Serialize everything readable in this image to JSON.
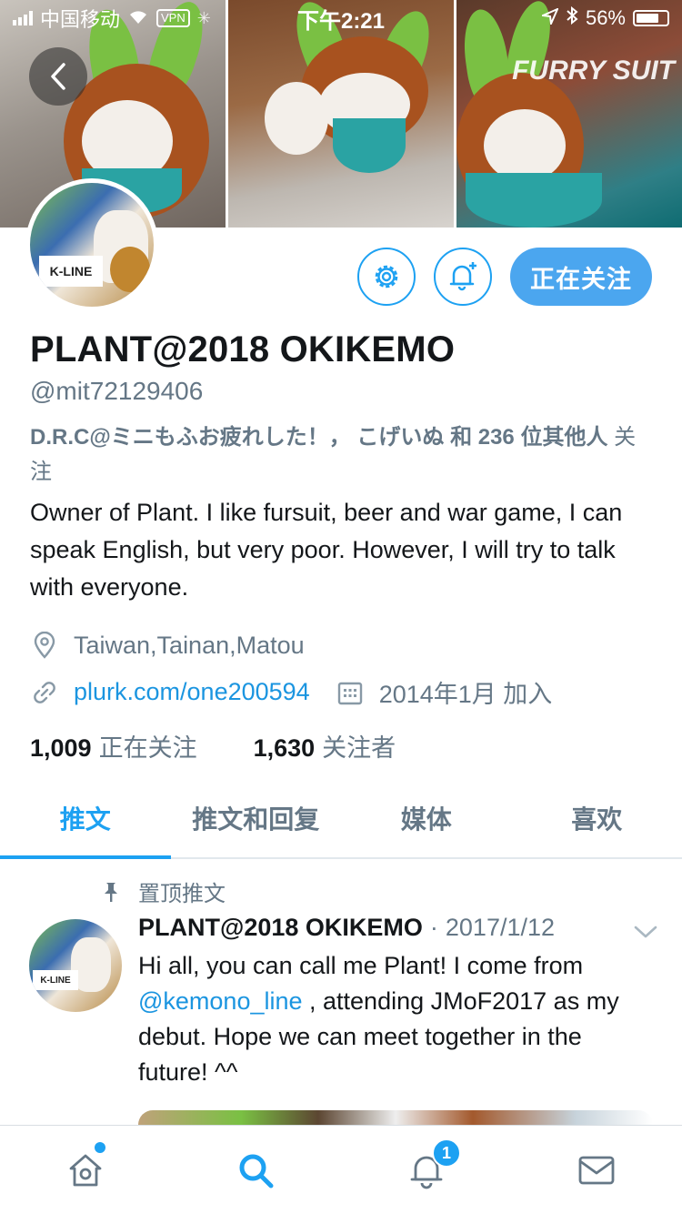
{
  "status_bar": {
    "carrier": "中国移动",
    "vpn": "VPN",
    "time": "下午2:21",
    "battery": "56%"
  },
  "banner": {
    "watermark": "FURRY SUIT"
  },
  "profile": {
    "display_name": "PLANT@2018 OKIKEMO",
    "handle": "@mit72129406",
    "followed_by_names": "D.R.C@ミニもふお疲れした！， こげいぬ 和 236 位其他人",
    "followed_by_suffix": " 关注",
    "bio": "Owner of Plant. I like fursuit, beer and war game, I can speak English, but very poor. However, I will try to talk with everyone.",
    "location": "Taiwan,Tainan,Matou",
    "website": "plurk.com/one200594",
    "joined": "2014年1月 加入",
    "following_count": "1,009",
    "following_label": "正在关注",
    "followers_count": "1,630",
    "followers_label": "关注者",
    "follow_button": "正在关注",
    "avatar_label": "K-LINE"
  },
  "tabs": [
    {
      "label": "推文",
      "active": true
    },
    {
      "label": "推文和回复",
      "active": false
    },
    {
      "label": "媒体",
      "active": false
    },
    {
      "label": "喜欢",
      "active": false
    }
  ],
  "pinned_tweet": {
    "pinned_label": "置顶推文",
    "author": "PLANT@2018 OKIKEMO",
    "separator": "·",
    "date": "2017/1/12",
    "text_before": "Hi all, you can call me Plant! I come from ",
    "mention": "@kemono_line",
    "text_after": " , attending JMoF2017 as my debut. Hope we can meet together in the future! ^^",
    "avatar_label": "K-LINE"
  },
  "bottom_nav": {
    "items": [
      "home-icon",
      "search-icon",
      "notifications-icon",
      "messages-icon"
    ],
    "notification_badge": "1"
  },
  "colors": {
    "accent": "#1da1f2",
    "link": "#1b95e0",
    "secondary_text": "#657786",
    "primary_text": "#14171a"
  }
}
